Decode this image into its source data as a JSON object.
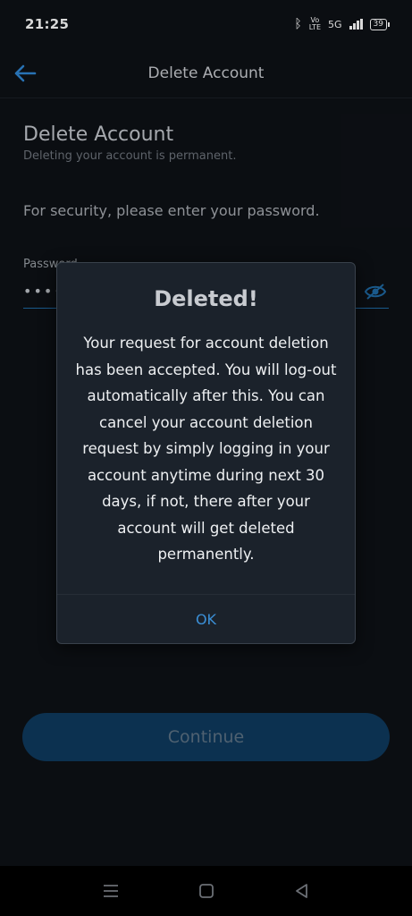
{
  "status_bar": {
    "time": "21:25",
    "network_volte": "Vo\nLTE",
    "network_5g": "5G",
    "battery": "39"
  },
  "app_bar": {
    "title": "Delete Account",
    "back_icon": "arrow-back-icon"
  },
  "page": {
    "heading": "Delete Account",
    "subheading": "Deleting your account is permanent.",
    "security_prompt": "For security, please enter your password.",
    "password_label": "Password",
    "password_value": "••••••••••",
    "visibility_icon": "eye-slash-icon",
    "continue_label": "Continue"
  },
  "dialog": {
    "title": "Deleted!",
    "message": "Your request for account deletion has been accepted. You will log-out automatically after this. You can cancel your account deletion request by simply logging in your account anytime during next 30 days, if not, there after your account will get deleted permanently.",
    "ok_label": "OK"
  },
  "colors": {
    "accent": "#1f6aa5",
    "dialog_bg": "#1b222b",
    "ok_text": "#3b8fd6",
    "continue_bg": "#0f3a5e"
  },
  "nav_bar": {
    "icons": [
      "menu-icon",
      "home-square-icon",
      "back-triangle-icon"
    ]
  }
}
